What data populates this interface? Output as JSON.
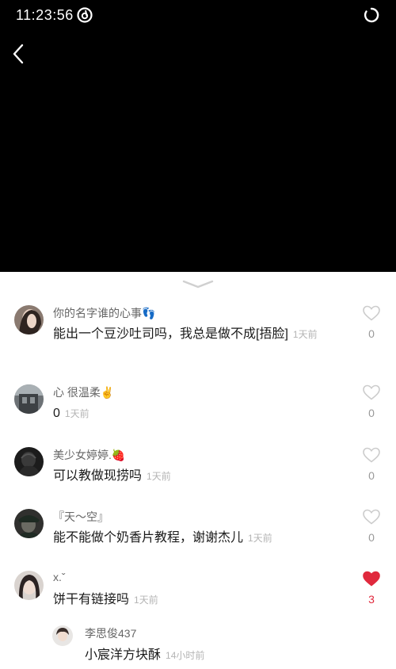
{
  "status_bar": {
    "time": "11:23:56"
  },
  "comments": [
    {
      "user": "你的名字谁的心事👣",
      "text": "能出一个豆沙吐司吗，我总是做不成[捂脸]",
      "time": "1天前",
      "likes": "0",
      "liked": false
    },
    {
      "user": "心  很温柔✌️",
      "text": "0",
      "time": "1天前",
      "likes": "0",
      "liked": false
    },
    {
      "user": "美少女婷婷.🍓",
      "text": "可以教做现捞吗",
      "time": "1天前",
      "likes": "0",
      "liked": false
    },
    {
      "user": "『天～空』",
      "text": "能不能做个奶香片教程，谢谢杰儿",
      "time": "1天前",
      "likes": "0",
      "liked": false
    },
    {
      "user": "x.ˇ",
      "text": "饼干有链接吗",
      "time": "1天前",
      "likes": "3",
      "liked": true
    }
  ],
  "reply": {
    "user": "李思俊437",
    "text": "小宸洋方块酥",
    "time": "14小时前"
  },
  "colors": {
    "like_active": "#e0293d",
    "like_inactive": "#cccccc",
    "time": "#b4b4b4"
  }
}
